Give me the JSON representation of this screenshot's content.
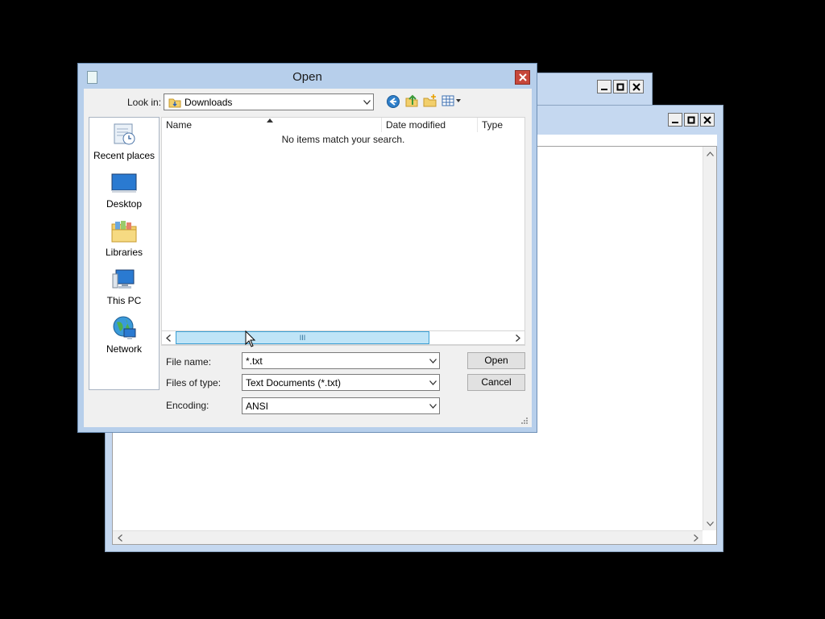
{
  "dialog": {
    "title": "Open",
    "look_in_label": "Look in:",
    "look_in_value": "Downloads",
    "toolbar_icons": [
      "back-icon",
      "up-folder-icon",
      "new-folder-icon",
      "view-menu-icon"
    ],
    "places": [
      {
        "label": "Recent places",
        "icon": "recent-places-icon"
      },
      {
        "label": "Desktop",
        "icon": "desktop-icon"
      },
      {
        "label": "Libraries",
        "icon": "libraries-icon"
      },
      {
        "label": "This PC",
        "icon": "this-pc-icon"
      },
      {
        "label": "Network",
        "icon": "network-icon"
      }
    ],
    "columns": [
      "Name",
      "Date modified",
      "Type"
    ],
    "empty_message": "No items match your search.",
    "file_name_label": "File name:",
    "file_name_value": "*.txt",
    "file_type_label": "Files of type:",
    "file_type_value": "Text Documents (*.txt)",
    "encoding_label": "Encoding:",
    "encoding_value": "ANSI",
    "open_button": "Open",
    "cancel_button": "Cancel",
    "scrollbar_thumb_grip": "III"
  },
  "colors": {
    "desktop": "#000000",
    "title_bar": "#b7cfeb",
    "close_button": "#c7473a",
    "scroll_thumb": "#bfe4f7"
  }
}
